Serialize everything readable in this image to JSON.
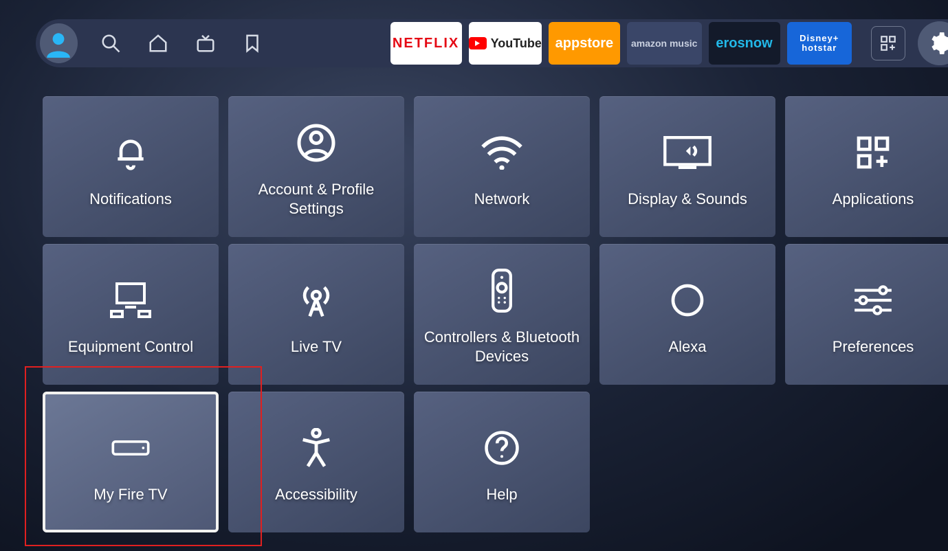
{
  "topbar": {
    "apps": {
      "netflix": "NETFLIX",
      "youtube": "YouTube",
      "appstore": "appstore",
      "amazonmusic": "amazon music",
      "erosnow": "erosnow",
      "hotstar": "Disney+ hotstar"
    }
  },
  "settings": {
    "row1": [
      {
        "label": "Notifications",
        "icon": "bell",
        "name": "tile-notifications"
      },
      {
        "label": "Account & Profile Settings",
        "icon": "account",
        "name": "tile-account-profile"
      },
      {
        "label": "Network",
        "icon": "wifi",
        "name": "tile-network"
      },
      {
        "label": "Display & Sounds",
        "icon": "display-sound",
        "name": "tile-display-sounds"
      },
      {
        "label": "Applications",
        "icon": "apps-add",
        "name": "tile-applications"
      }
    ],
    "row2": [
      {
        "label": "Equipment Control",
        "icon": "equipment",
        "name": "tile-equipment-control"
      },
      {
        "label": "Live TV",
        "icon": "antenna",
        "name": "tile-live-tv"
      },
      {
        "label": "Controllers & Bluetooth Devices",
        "icon": "remote",
        "name": "tile-controllers-bluetooth"
      },
      {
        "label": "Alexa",
        "icon": "alexa-ring",
        "name": "tile-alexa"
      },
      {
        "label": "Preferences",
        "icon": "sliders",
        "name": "tile-preferences"
      }
    ],
    "row3": [
      {
        "label": "My Fire TV",
        "icon": "device",
        "name": "tile-my-fire-tv",
        "selected": true
      },
      {
        "label": "Accessibility",
        "icon": "accessibility",
        "name": "tile-accessibility"
      },
      {
        "label": "Help",
        "icon": "help",
        "name": "tile-help"
      }
    ]
  }
}
